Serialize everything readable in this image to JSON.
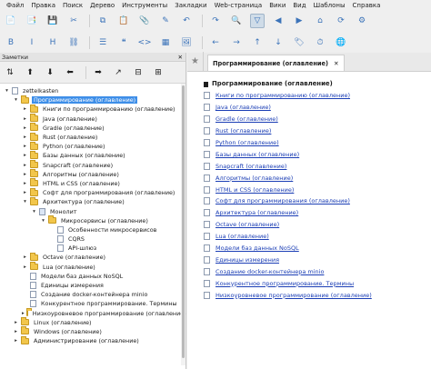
{
  "menu": [
    "Файл",
    "Правка",
    "Поиск",
    "Дерево",
    "Инструменты",
    "Закладки",
    "Web-страница",
    "Вики",
    "Вид",
    "Шаблоны",
    "Справка"
  ],
  "toolbar1": [
    {
      "icon": "new-page-icon",
      "glyph": "📄"
    },
    {
      "icon": "add-child-icon",
      "glyph": "📑"
    },
    {
      "icon": "save-icon",
      "glyph": "💾"
    },
    {
      "icon": "cut-icon",
      "glyph": "✂"
    },
    {
      "icon": "copy-icon",
      "glyph": "⧉"
    },
    {
      "icon": "paste-icon",
      "glyph": "📋"
    },
    {
      "icon": "attach-icon",
      "glyph": "📎"
    },
    {
      "icon": "edit-icon",
      "glyph": "✎"
    },
    {
      "icon": "undo-icon",
      "glyph": "↶"
    },
    {
      "icon": "redo-icon",
      "glyph": "↷"
    },
    {
      "icon": "search-icon",
      "glyph": "🔍"
    },
    {
      "icon": "filter-icon",
      "glyph": "▽",
      "active": true
    },
    {
      "icon": "back-icon",
      "glyph": "◀"
    },
    {
      "icon": "forward-icon",
      "glyph": "▶"
    },
    {
      "icon": "home-icon",
      "glyph": "⌂"
    },
    {
      "icon": "refresh-icon",
      "glyph": "⟳"
    },
    {
      "icon": "settings-icon",
      "glyph": "⚙"
    }
  ],
  "toolbar2": [
    {
      "icon": "bold-icon",
      "glyph": "B"
    },
    {
      "icon": "italic-icon",
      "glyph": "I"
    },
    {
      "icon": "heading-icon",
      "glyph": "H"
    },
    {
      "icon": "link-icon",
      "glyph": "⛓"
    },
    {
      "icon": "list-icon",
      "glyph": "☰"
    },
    {
      "icon": "quote-icon",
      "glyph": "❝"
    },
    {
      "icon": "code-icon",
      "glyph": "<>"
    },
    {
      "icon": "table-icon",
      "glyph": "▦"
    },
    {
      "icon": "image-icon",
      "glyph": "🖼"
    },
    {
      "icon": "arrow-left-icon",
      "glyph": "←"
    },
    {
      "icon": "arrow-right-icon",
      "glyph": "→"
    },
    {
      "icon": "arrow-up-icon",
      "glyph": "↑"
    },
    {
      "icon": "arrow-down-icon",
      "glyph": "↓"
    },
    {
      "icon": "tag-icon",
      "glyph": "🏷"
    },
    {
      "icon": "clock-icon",
      "glyph": "⏱"
    },
    {
      "icon": "globe-icon",
      "glyph": "🌐"
    }
  ],
  "left_panel": {
    "title": "Заметки",
    "close": "✕",
    "tools": [
      {
        "icon": "sort-icon",
        "glyph": "⇅"
      },
      {
        "icon": "move-up-icon",
        "glyph": "⬆"
      },
      {
        "icon": "move-down-icon",
        "glyph": "⬇"
      },
      {
        "icon": "move-left-icon",
        "glyph": "⬅"
      },
      {
        "icon": "move-right-icon",
        "glyph": "➡"
      },
      {
        "icon": "goto-icon",
        "glyph": "↗"
      },
      {
        "icon": "collapse-icon",
        "glyph": "⊟"
      },
      {
        "icon": "expand-icon",
        "glyph": "⊞"
      }
    ]
  },
  "tree": [
    {
      "level": 0,
      "arrow": "▾",
      "type": "doc",
      "label": "zettelkasten"
    },
    {
      "level": 1,
      "arrow": "▾",
      "type": "folder",
      "label": "Программирование (оглавление)",
      "selected": true
    },
    {
      "level": 2,
      "arrow": "▸",
      "type": "folder",
      "label": "Книги по программированию (оглавление)"
    },
    {
      "level": 2,
      "arrow": "▸",
      "type": "folder",
      "label": "Java (оглавление)"
    },
    {
      "level": 2,
      "arrow": "▸",
      "type": "folder",
      "label": "Gradle (оглавление)"
    },
    {
      "level": 2,
      "arrow": "▸",
      "type": "folder",
      "label": "Rust (оглавление)"
    },
    {
      "level": 2,
      "arrow": "▸",
      "type": "folder",
      "label": "Python (оглавление)"
    },
    {
      "level": 2,
      "arrow": "▸",
      "type": "folder",
      "label": "Базы данных (оглавление)"
    },
    {
      "level": 2,
      "arrow": "▸",
      "type": "folder",
      "label": "Snapcraft (оглавление)"
    },
    {
      "level": 2,
      "arrow": "▸",
      "type": "folder",
      "label": "Алгоритмы (оглавление)"
    },
    {
      "level": 2,
      "arrow": "▸",
      "type": "folder",
      "label": "HTML и CSS (оглавление)"
    },
    {
      "level": 2,
      "arrow": "▸",
      "type": "folder",
      "label": "Софт для программирования (оглавление)"
    },
    {
      "level": 2,
      "arrow": "▾",
      "type": "folder",
      "label": "Архитектура (оглавление)"
    },
    {
      "level": 3,
      "arrow": "▾",
      "type": "doc",
      "blue": true,
      "label": "Монолит"
    },
    {
      "level": 4,
      "arrow": "▾",
      "type": "folder",
      "label": "Микросервисы (оглавление)"
    },
    {
      "level": 5,
      "arrow": "",
      "type": "doc",
      "label": "Особенности микросервисов"
    },
    {
      "level": 5,
      "arrow": "",
      "type": "doc",
      "label": "CQRS"
    },
    {
      "level": 5,
      "arrow": "",
      "type": "doc",
      "label": "API-шлюз"
    },
    {
      "level": 2,
      "arrow": "▸",
      "type": "folder",
      "label": "Octave (оглавление)"
    },
    {
      "level": 2,
      "arrow": "▸",
      "type": "folder",
      "label": "Lua (оглавление)"
    },
    {
      "level": 2,
      "arrow": "",
      "type": "doc",
      "label": "Модели баз данных NoSQL"
    },
    {
      "level": 2,
      "arrow": "",
      "type": "doc",
      "label": "Единицы измерения"
    },
    {
      "level": 2,
      "arrow": "",
      "type": "doc",
      "label": "Создание docker-контейнера minio"
    },
    {
      "level": 2,
      "arrow": "",
      "type": "doc",
      "label": "Конкурентное программирование. Термины"
    },
    {
      "level": 2,
      "arrow": "▸",
      "type": "folder",
      "label": "Низкоуровневое программирование (оглавление)"
    },
    {
      "level": 1,
      "arrow": "▸",
      "type": "folder",
      "label": "Linux (оглавление)"
    },
    {
      "level": 1,
      "arrow": "▸",
      "type": "folder",
      "label": "Windows (оглавление)"
    },
    {
      "level": 1,
      "arrow": "▸",
      "type": "folder",
      "label": "Администрирование (оглавление)"
    }
  ],
  "editor": {
    "star": "★",
    "tab_label": "Программирование (оглавление)",
    "tab_close": "✕",
    "heading": "Программирование (оглавление)",
    "links": [
      "Книги по программированию (оглавление)",
      "Java (оглавление)",
      "Gradle (оглавление)",
      "Rust (оглавление)",
      "Python (оглавление)",
      "Базы данных (оглавление)",
      "Snapcraft (оглавление)",
      "Алгоритмы (оглавление)",
      "HTML и CSS (оглавление)",
      "Софт для программирования (оглавление)",
      "Архитектура (оглавление)",
      "Octave (оглавление)",
      "Lua (оглавление)",
      "Модели баз данных NoSQL",
      "Единицы измерения",
      "Создание docker-контейнера minio",
      "Конкурентное программирование. Термины",
      "Низкоуровневое программирование (оглавление)"
    ]
  },
  "colors": {
    "selection": "#3d8ee8",
    "link": "#1b3eb5",
    "folder": "#f2c64b"
  }
}
